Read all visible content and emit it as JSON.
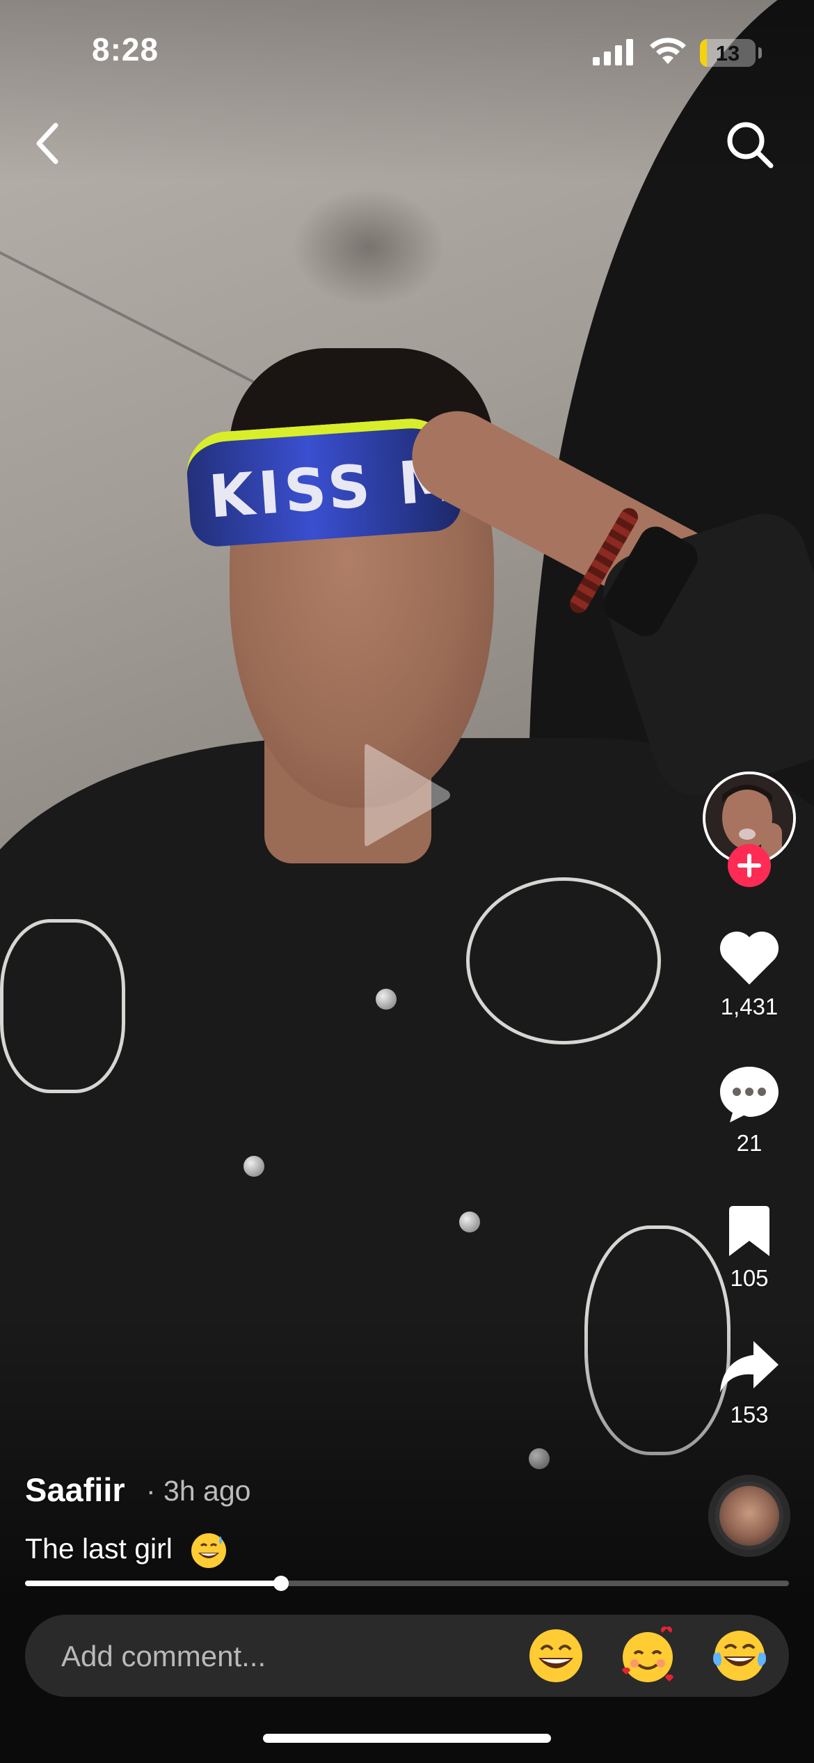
{
  "status_bar": {
    "time": "8:28",
    "battery_level": "13",
    "battery_color": "#f5d20a"
  },
  "nav": {
    "back_icon": "chevron-left-icon",
    "search_icon": "search-icon"
  },
  "video": {
    "state": "paused",
    "overlay_icon": "play-icon",
    "visor_text": "KISS ME"
  },
  "actions": {
    "follow_icon": "plus-icon",
    "likes": "1,431",
    "comments": "21",
    "bookmarks": "105",
    "shares": "153"
  },
  "post": {
    "author": "Saafiir",
    "time": "· 3h ago",
    "caption": "The last girl",
    "caption_emoji": "grinning-face-with-sweat"
  },
  "playback": {
    "progress": 0.335
  },
  "comment_bar": {
    "placeholder": "Add comment...",
    "quick_emojis": [
      "beaming-face",
      "smiling-face-with-hearts",
      "face-with-tears-of-joy"
    ]
  },
  "colors": {
    "accent": "#fe2c55",
    "comment_box": "#2a2a2a",
    "bottom_bar": "#0b0b0b"
  }
}
